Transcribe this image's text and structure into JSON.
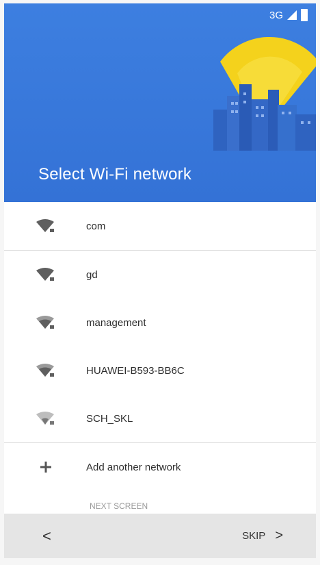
{
  "status_bar": {
    "network": "3G",
    "signal_icon": "signal-icon",
    "battery_icon": "battery-icon"
  },
  "header": {
    "title": "Select Wi-Fi network",
    "bg_color": "#3b7ddd",
    "accent": "#f4d21c"
  },
  "networks": [
    {
      "name": "com",
      "icon": "wifi-secured-icon"
    },
    {
      "name": "gd",
      "icon": "wifi-secured-icon"
    },
    {
      "name": "management",
      "icon": "wifi-secured-icon"
    },
    {
      "name": "HUAWEI-B593-BB6C",
      "icon": "wifi-secured-icon"
    },
    {
      "name": "SCH_SKL",
      "icon": "wifi-secured-icon"
    }
  ],
  "add_network": {
    "label": "Add another network",
    "icon": "plus-icon"
  },
  "more_label": "NEXT SCREEN",
  "footer": {
    "back_label": "<",
    "skip_label": "SKIP",
    "skip_chevron": ">"
  }
}
